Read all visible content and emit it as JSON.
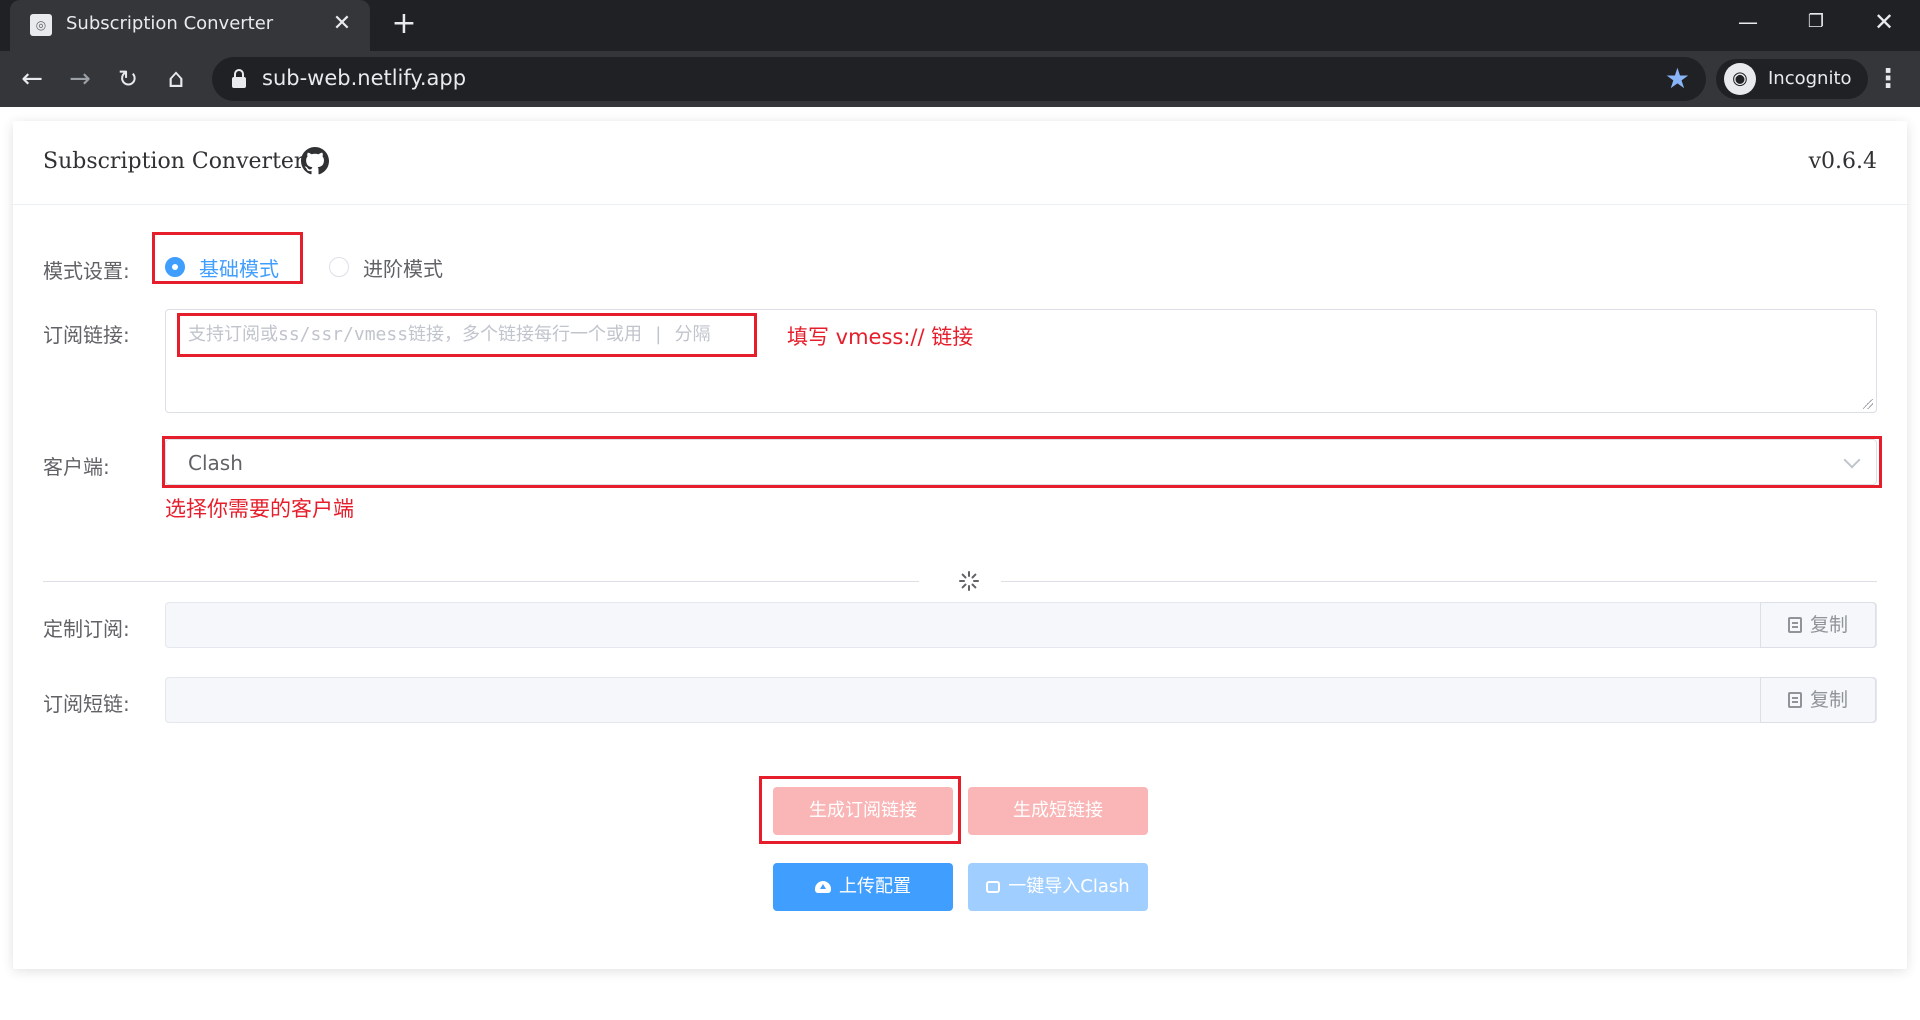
{
  "browser": {
    "tab_title": "Subscription Converter",
    "tab_close": "✕",
    "new_tab": "+",
    "url": "sub-web.netlify.app",
    "profile_label": "Incognito",
    "window_min": "—",
    "window_max": "❐",
    "window_close": "✕"
  },
  "header": {
    "title": "Subscription Converter",
    "version": "v0.6.4"
  },
  "mode": {
    "label": "模式设置:",
    "options": [
      {
        "label": "基础模式",
        "checked": true
      },
      {
        "label": "进阶模式",
        "checked": false
      }
    ]
  },
  "subscription": {
    "label": "订阅链接:",
    "placeholder": "支持订阅或ss/ssr/vmess链接，多个链接每行一个或用 | 分隔",
    "annotation": "填写 vmess:// 链接"
  },
  "client": {
    "label": "客户端:",
    "value": "Clash",
    "annotation": "选择你需要的客户端"
  },
  "custom_sub": {
    "label": "定制订阅:",
    "copy_label": "复制"
  },
  "short_link": {
    "label": "订阅短链:",
    "copy_label": "复制"
  },
  "buttons": {
    "generate_sub": "生成订阅链接",
    "generate_short": "生成短链接",
    "upload_config": "上传配置",
    "import_clash": "一键导入Clash"
  },
  "colors": {
    "annotation_red": "#e61e2b",
    "primary": "#409eff",
    "danger_disabled": "#fab6b6"
  }
}
